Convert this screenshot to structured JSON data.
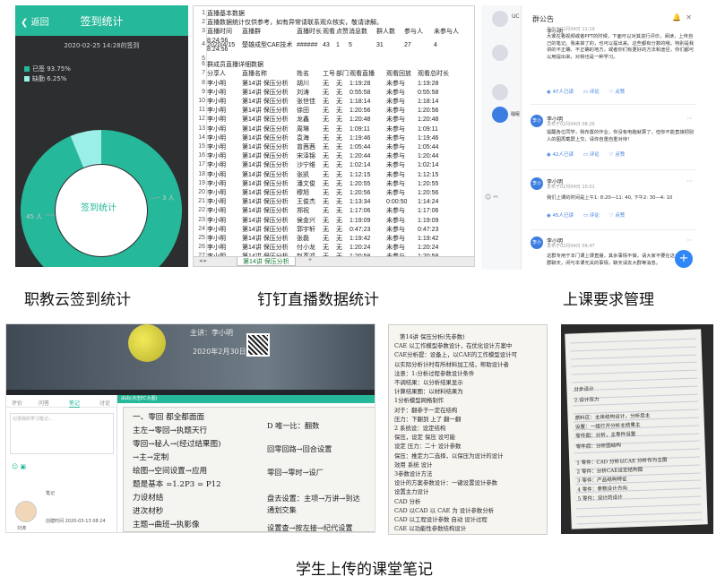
{
  "checkin": {
    "back": "返回",
    "title": "签到统计",
    "datetime": "2020-02-25 14:28的签到",
    "legend": [
      {
        "label": "已签 93.75%",
        "color": "#26b89a"
      },
      {
        "label": "缺勤 6.25%",
        "color": "#9af0e8"
      }
    ],
    "center_label": "签到统计",
    "label_present": "45 人",
    "label_absent": "3 人",
    "present_fraction": 0.9375
  },
  "sheet": {
    "r1": "直播基本数据",
    "r2": "直播数据统计仅供参考，如有异常请联系观众核实，敬请谅解。",
    "header": [
      "直播时间",
      "直播群",
      "直播时长",
      "观看人数",
      "点赞数",
      "消息数",
      "群人数",
      "参与人",
      "未参与人"
    ],
    "r4": [
      "2020/4/15",
      "楚雄成型CAE技术",
      "######",
      "43",
      "1",
      "5",
      "31",
      "27",
      "4"
    ],
    "r4b": "8:24:56",
    "section": "群成员直播详细数据",
    "dheader": [
      "分享人",
      "直播名称",
      "姓名",
      "工号",
      "部门",
      "观看直播",
      "观看回放",
      "观看总时长"
    ],
    "rows": [
      [
        "李小明",
        "第14讲 保压分析",
        "胡川",
        "无",
        "无",
        "1:19:28",
        "未参与",
        "1:19:28"
      ],
      [
        "李小明",
        "第14讲 保压分析",
        "刘涛",
        "无",
        "无",
        "0:55:58",
        "未参与",
        "0:55:58"
      ],
      [
        "李小明",
        "第14讲 保压分析",
        "张世佳",
        "无",
        "无",
        "1:18:14",
        "未参与",
        "1:18:14"
      ],
      [
        "李小明",
        "第14讲 保压分析",
        "徐田",
        "无",
        "无",
        "1:20:56",
        "未参与",
        "1:20:56"
      ],
      [
        "李小明",
        "第14讲 保压分析",
        "龙鑫",
        "无",
        "无",
        "1:20:48",
        "未参与",
        "1:20:48"
      ],
      [
        "李小明",
        "第14讲 保压分析",
        "周琳",
        "无",
        "无",
        "1:09:11",
        "未参与",
        "1:09:11"
      ],
      [
        "李小明",
        "第14讲 保压分析",
        "袁海",
        "无",
        "无",
        "1:19:46",
        "未参与",
        "1:19:46"
      ],
      [
        "李小明",
        "第14讲 保压分析",
        "曾茜茜",
        "无",
        "无",
        "1:05:44",
        "未参与",
        "1:05:44"
      ],
      [
        "李小明",
        "第14讲 保压分析",
        "宋泽锦",
        "无",
        "无",
        "1:20:44",
        "未参与",
        "1:20:44"
      ],
      [
        "李小明",
        "第14讲 保压分析",
        "沙宁维",
        "无",
        "无",
        "1:02:14",
        "未参与",
        "1:02:14"
      ],
      [
        "李小明",
        "第14讲 保压分析",
        "张凯",
        "无",
        "无",
        "1:12:15",
        "未参与",
        "1:12:15"
      ],
      [
        "李小明",
        "第14讲 保压分析",
        "潘文俊",
        "无",
        "无",
        "1:20:55",
        "未参与",
        "1:20:55"
      ],
      [
        "李小明",
        "第14讲 保压分析",
        "穆旭",
        "无",
        "无",
        "1:20:56",
        "未参与",
        "1:20:56"
      ],
      [
        "李小明",
        "第14讲 保压分析",
        "王俊杰",
        "无",
        "无",
        "1:13:34",
        "0:00:50",
        "1:14:24"
      ],
      [
        "李小明",
        "第14讲 保压分析",
        "郑祝",
        "无",
        "无",
        "1:17:06",
        "未参与",
        "1:17:06"
      ],
      [
        "李小明",
        "第14讲 保压分析",
        "侯金兴",
        "无",
        "无",
        "1:19:09",
        "未参与",
        "1:19:09"
      ],
      [
        "李小明",
        "第14讲 保压分析",
        "郭宇轩",
        "无",
        "无",
        "0:47:23",
        "未参与",
        "0:47:23"
      ],
      [
        "李小明",
        "第14讲 保压分析",
        "张磊",
        "无",
        "无",
        "1:19:42",
        "未参与",
        "1:19:42"
      ],
      [
        "李小明",
        "第14讲 保压分析",
        "付小龙",
        "无",
        "无",
        "1:20:24",
        "未参与",
        "1:20:24"
      ],
      [
        "李小明",
        "第14讲 保压分析",
        "赵英鸿",
        "无",
        "无",
        "1:20:58",
        "未参与",
        "1:20:58"
      ],
      [
        "李小明",
        "第14讲 保压分析",
        "向鸿翔",
        "无",
        "无",
        "1:07:37",
        "未参与",
        "1:07:37"
      ],
      [
        "李小明",
        "第14讲 保压分析",
        "杜宇飞",
        "无",
        "无",
        "1:20:36",
        "未参与",
        "1:20:36"
      ],
      [
        "李小明",
        "第14讲 保压分析",
        "孙静",
        "无",
        "无",
        "1:20:57",
        "未参与",
        "1:20:57"
      ]
    ],
    "tab": "第14讲 保压分析",
    "add": "+"
  },
  "notice": {
    "title": "群公告",
    "side_label": "UC",
    "side_name": "睡眠",
    "cards": [
      {
        "name": "李小明",
        "meta": "发布于02月04日 11:19",
        "text": "大家在看视频或者PPT的时候，下面可以对其进行评价，阅读，上传自己的笔记。我来掉了的，也可以提出来。这些都有分数的哦。特别是我讲的不正确、不正确的地方，或者你们有更好的方法和途径，你们都可以用提出来，对我也是一种学习。",
        "read": "47人已读",
        "comment": "评论",
        "like": "点赞"
      },
      {
        "name": "李小明",
        "meta": "发布于02月04日 08:26",
        "text": "提醒各位同学，我布置的作业，你没有电脑就算了，但你不能直接把别人的图再截屏上交，请你自重自重对待！",
        "read": "42人已读",
        "comment": "评论",
        "like": "点赞"
      },
      {
        "name": "李小明",
        "meta": "发布于02月04日 10:51",
        "text": "我们上课的时间是上午1: 8:20—11: 40, 下午2: 30—4: 10",
        "read": "45人已读",
        "comment": "评论",
        "like": "点赞"
      },
      {
        "name": "李小明",
        "meta": "发布于02月04日 09:47",
        "text": "这群专用于本门课上课直播，其余事情不做，请大家不要在这个群聊天，闲与本课无关的事情，聊天请去大群等消息。"
      }
    ],
    "fab": "+"
  },
  "captions": {
    "c1": "职教云签到统计",
    "c2": "钉钉直播数据统计",
    "c3": "上课要求管理",
    "c4": "学生上传的课堂笔记"
  },
  "video": {
    "title": "主讲：李小明",
    "date": "2020年2月30日",
    "tabs": [
      "评价",
      "问答",
      "笔记",
      "讨论"
    ],
    "placeholder": "记录我的学习笔记...",
    "note_label": "笔记",
    "user": "刘涛",
    "created": "创建时间 2020-03-13 08:24",
    "notes_header": "由由(点击EC大图)",
    "hw_left": [
      "一、零回   都全都面面",
      "主左→零回→执题天行",
      "零回→秘人→(经过结果图)",
      "  →主→定制",
      "绘图→空间设置→应用",
      "题是基本 =1.2P3 = P12",
      "力设材结",
      "进次材秒",
      "主题→曲班→执影像"
    ],
    "hw_right": [
      "D 唯一比：翻数",
      "回零回路→回合设置",
      "零回→零时→设厂",
      "盘去设置：主项→万讲→到达",
      "通划交集",
      "设置查→按左接→纪代设置"
    ]
  },
  "photo1": {
    "lines": [
      "第14讲 保压分析(先参数)",
      "CAE 以工作模型参数设计，在优化设计方案中",
      "CAE分析提：设备上，以CAE的工作模型设计可",
      "以实际分析计时有所材料加工结，帮助设计者",
      "注意：1:分析过程参数设计条件",
      "   不调结果：以分析结果显示",
      "   计算结果图：以材料结果为",
      "1分析模型网格制作",
      "对于：翻参于一定在结构",
      "   压力：下翻到 上了 翻一翻",
      "2 系统设：设定结构",
      "   保压，设定 保压 设可能",
      "设定 压力：二十 设计参数",
      "保压：推定力二选择，以保压为设计的设计",
      "   效用 系统 设计",
      "3参数设计方法",
      "  设计的方案参数设计：一键设置设计参数",
      "  设置主力设计",
      "CAD 分析",
      "CAD 以CAD 以 CAE 为 设计参数分析",
      "CAD 以工程设计参数 自动 设计过程",
      "CAE 以功能性参数结构设计"
    ]
  },
  "photo2": {
    "lines": [
      "分步设计",
      "2.设计压力",
      "原料区：主体结构设计，分析后主",
      "设置：一组打开分析主结果主",
      "零件图：分析，主零件设置",
      "零件后：分析图结构",
      "1 零件：CAD 分析以CAE 分析作为主图",
      "2 零件：分析CAE设定结构图",
      "3 零件：产品结构特征",
      "4 零件：参数设计方向",
      "5 零件：设计的设计"
    ]
  }
}
